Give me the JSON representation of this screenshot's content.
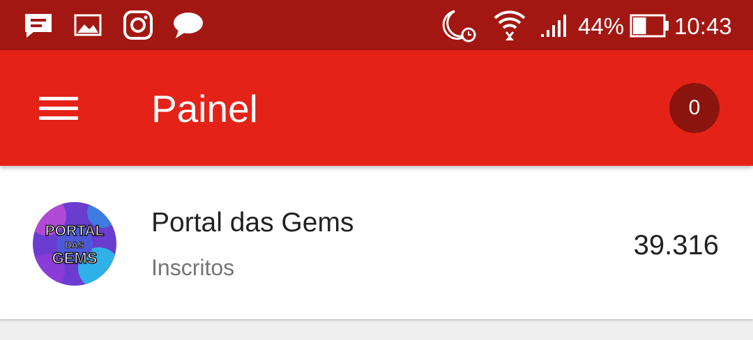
{
  "status_bar": {
    "notification_icons": [
      "message-notification-icon",
      "gallery-icon",
      "instagram-icon",
      "chat-bubble-icon"
    ],
    "system_icons": [
      "do-not-disturb-alarm-icon",
      "wifi-icon",
      "cellular-signal-icon",
      "battery-icon"
    ],
    "battery": "44%",
    "battery_level": 0.44,
    "time": "10:43"
  },
  "app_bar": {
    "menu_icon": "hamburger-menu-icon",
    "title": "Painel",
    "badge": "0"
  },
  "channel": {
    "name": "Portal das Gems",
    "subtitle": "Inscritos",
    "count": "39.316",
    "avatar_text": [
      "PORTAL",
      "DAS",
      "GEMS"
    ]
  },
  "colors": {
    "status_bar": "#a31712",
    "app_bar": "#e52218",
    "badge": "#8c140e"
  }
}
